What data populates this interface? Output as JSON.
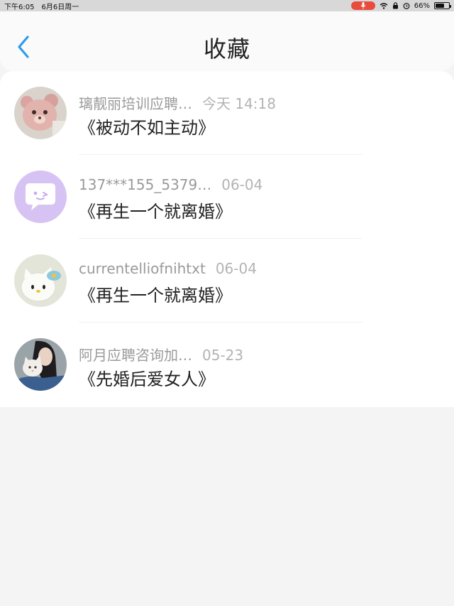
{
  "status_bar": {
    "time": "下午6:05",
    "date": "6月6日周一",
    "battery": "66%",
    "battery_level": 0.66
  },
  "header": {
    "title": "收藏",
    "back_icon": "chevron-left-icon",
    "accent_color": "#2f9bea"
  },
  "favorites": [
    {
      "user": "璃靓丽培训应聘…",
      "time": "今天 14:18",
      "title": "《被动不如主动》",
      "avatar": "pink-bear-avatar"
    },
    {
      "user": "137***155_5379…",
      "time": "06-04",
      "title": "《再生一个就离婚》",
      "avatar": "purple-chat-avatar"
    },
    {
      "user": "currentelliofnihtxt",
      "time": "06-04",
      "title": "《再生一个就离婚》",
      "avatar": "hello-kitty-avatar"
    },
    {
      "user": "阿月应聘咨询加…",
      "time": "05-23",
      "title": "《先婚后爱女人》",
      "avatar": "girl-with-cat-avatar"
    }
  ]
}
